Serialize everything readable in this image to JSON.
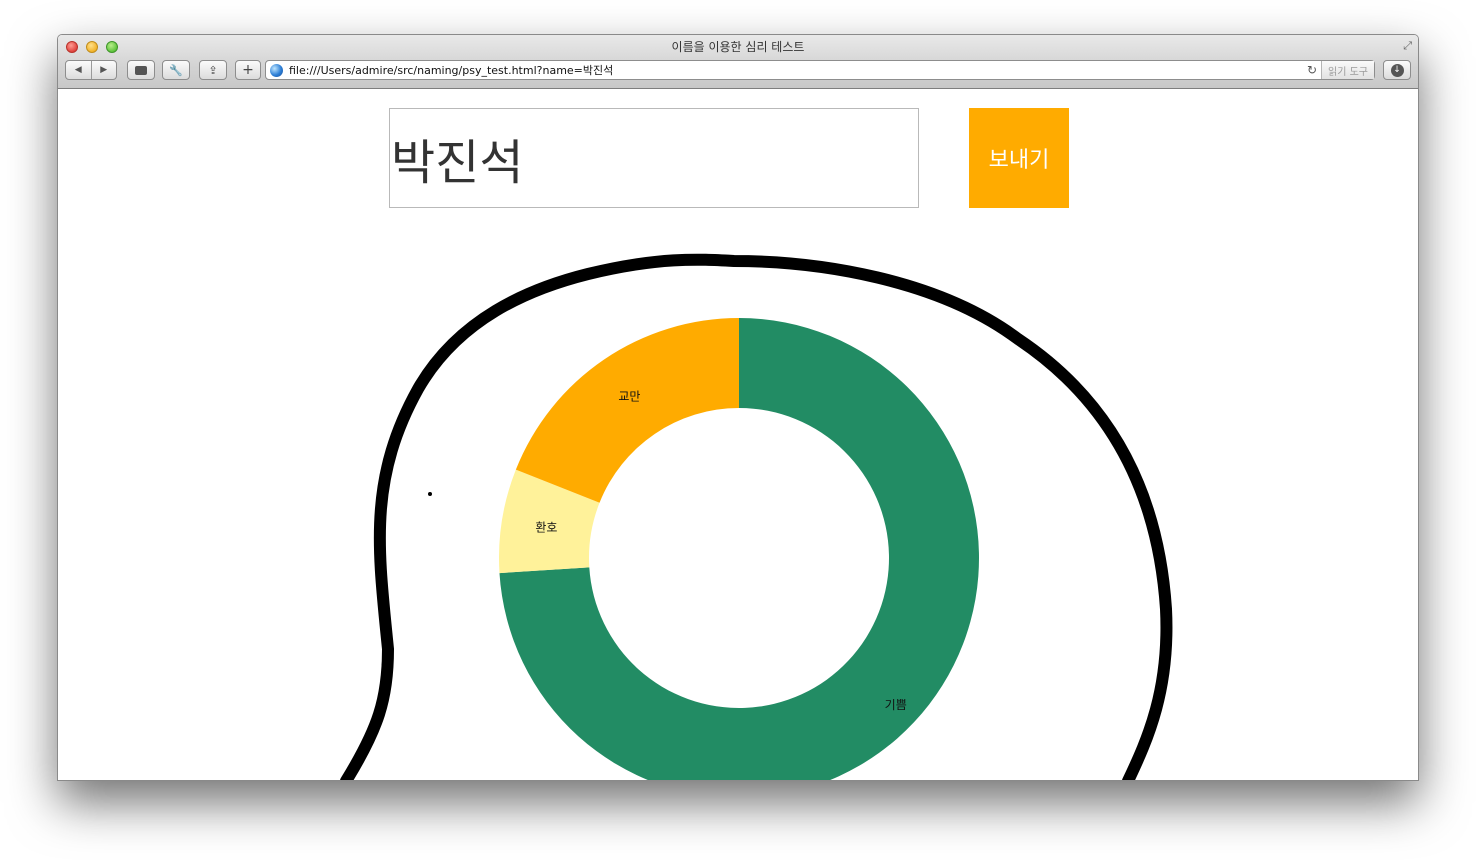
{
  "window": {
    "title": "이름을 이용한 심리 테스트",
    "url": "file:///Users/admire/src/naming/psy_test.html?name=박진석",
    "reader_label": "읽기 도구"
  },
  "form": {
    "name_value": "박진석",
    "send_label": "보내기",
    "send_color": "#ffab00"
  },
  "chart_data": {
    "type": "pie",
    "donut": true,
    "categories": [
      "기쁨",
      "환호",
      "교만"
    ],
    "values": [
      74,
      7,
      19
    ],
    "colors": [
      "#228c64",
      "#fff29a",
      "#ffab00"
    ]
  }
}
